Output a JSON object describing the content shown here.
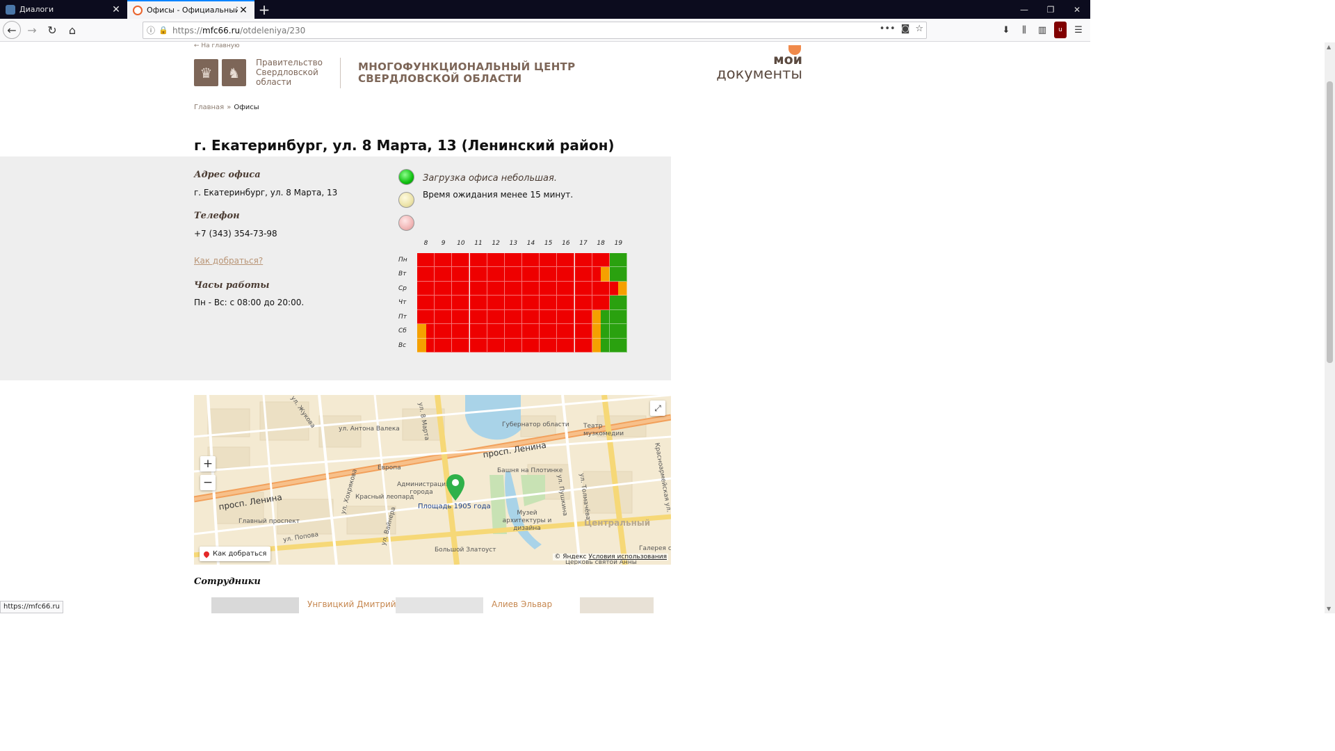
{
  "browser": {
    "tabs": [
      {
        "title": "Диалоги",
        "active": false
      },
      {
        "title": "Офисы - Официальный сайт",
        "active": true
      }
    ],
    "url_prefix": "https://",
    "url_host": "mfc66.ru",
    "url_path": "/otdeleniya/230",
    "status_url": "https://mfc66.ru"
  },
  "header": {
    "back_link": "← На главную",
    "gov_text": "Правительство Свердловской области",
    "center_title_1": "МНОГОФУНКЦИОНАЛЬНЫЙ ЦЕНТР",
    "center_title_2": "СВЕРДЛОВСКОЙ ОБЛАСТИ",
    "brand_1": "мои",
    "brand_2": "документы"
  },
  "breadcrumbs": {
    "home": "Главная",
    "separator": "»",
    "current": "Офисы"
  },
  "office": {
    "title": "г. Екатеринбург, ул. 8 Марта, 13 (Ленинский район)",
    "address_label": "Адрес офиса",
    "address": "г. Екатеринбург, ул. 8 Марта, 13",
    "phone_label": "Телефон",
    "phone": "+7 (343) 354-73-98",
    "route_link": "Как добраться?",
    "hours_label": "Часы работы",
    "hours": "Пн - Вс: с 08:00 до 20:00.",
    "load_status": "Загрузка офиса небольшая.",
    "wait_text": "Время ожидания менее 15 минут."
  },
  "colors": {
    "high": "#ee0000",
    "medium": "#f5a000",
    "low": "#2aa10f"
  },
  "load_chart": {
    "hours": [
      "8",
      "9",
      "10",
      "11",
      "12",
      "13",
      "14",
      "15",
      "16",
      "17",
      "18",
      "19"
    ],
    "days": [
      "Пн",
      "Вт",
      "Ср",
      "Чт",
      "Пт",
      "Сб",
      "Вс"
    ],
    "slots_per_day": 24,
    "rows": [
      [
        "r",
        "r",
        "r",
        "r",
        "r",
        "r",
        "r",
        "r",
        "r",
        "r",
        "r",
        "r",
        "r",
        "r",
        "r",
        "r",
        "r",
        "r",
        "r",
        "r",
        "r",
        "r",
        "g",
        "g"
      ],
      [
        "r",
        "r",
        "r",
        "r",
        "r",
        "r",
        "r",
        "r",
        "r",
        "r",
        "r",
        "r",
        "r",
        "r",
        "r",
        "r",
        "r",
        "r",
        "r",
        "r",
        "r",
        "o",
        "g",
        "g"
      ],
      [
        "r",
        "r",
        "r",
        "r",
        "r",
        "r",
        "r",
        "r",
        "r",
        "r",
        "r",
        "r",
        "r",
        "r",
        "r",
        "r",
        "r",
        "r",
        "r",
        "r",
        "r",
        "r",
        "r",
        "o"
      ],
      [
        "r",
        "r",
        "r",
        "r",
        "r",
        "r",
        "r",
        "r",
        "r",
        "r",
        "r",
        "r",
        "r",
        "r",
        "r",
        "r",
        "r",
        "r",
        "r",
        "r",
        "r",
        "r",
        "g",
        "g"
      ],
      [
        "r",
        "r",
        "r",
        "r",
        "r",
        "r",
        "r",
        "r",
        "r",
        "r",
        "r",
        "r",
        "r",
        "r",
        "r",
        "r",
        "r",
        "r",
        "r",
        "r",
        "o",
        "g",
        "g",
        "g"
      ],
      [
        "o",
        "r",
        "r",
        "r",
        "r",
        "r",
        "r",
        "r",
        "r",
        "r",
        "r",
        "r",
        "r",
        "r",
        "r",
        "r",
        "r",
        "r",
        "r",
        "r",
        "o",
        "g",
        "g",
        "g"
      ],
      [
        "o",
        "r",
        "r",
        "r",
        "r",
        "r",
        "r",
        "r",
        "r",
        "r",
        "r",
        "r",
        "r",
        "r",
        "r",
        "r",
        "r",
        "r",
        "r",
        "r",
        "o",
        "g",
        "g",
        "g"
      ]
    ]
  },
  "map": {
    "route_button": "Как добраться",
    "copyright": "© Яндекс",
    "terms": "Условия использования",
    "labels": [
      "ул. Антона Валека",
      "ул. 8 Марта",
      "Губернатор области",
      "Театр музкомедии",
      "просп. Ленина",
      "Европа",
      "Башня на Плотинке",
      "Администрация города",
      "Красный леопард",
      "Площадь 1905 года",
      "Музей архитектуры и дизайна",
      "Центральный",
      "Главный проспект",
      "ул. Попова",
      "Большой Златоуст",
      "Церковь святой Анны",
      "ул. Пушкина",
      "ул. Толмачёва",
      "Красноармейская ул.",
      "ул. Жукова",
      "ул. Хохрякова",
      "ул. Вайнера",
      "Галерея со"
    ]
  },
  "staff": {
    "heading": "Сотрудники",
    "people": [
      "Унгвицкий Дмитрий",
      "Алиев Эльвар"
    ]
  }
}
